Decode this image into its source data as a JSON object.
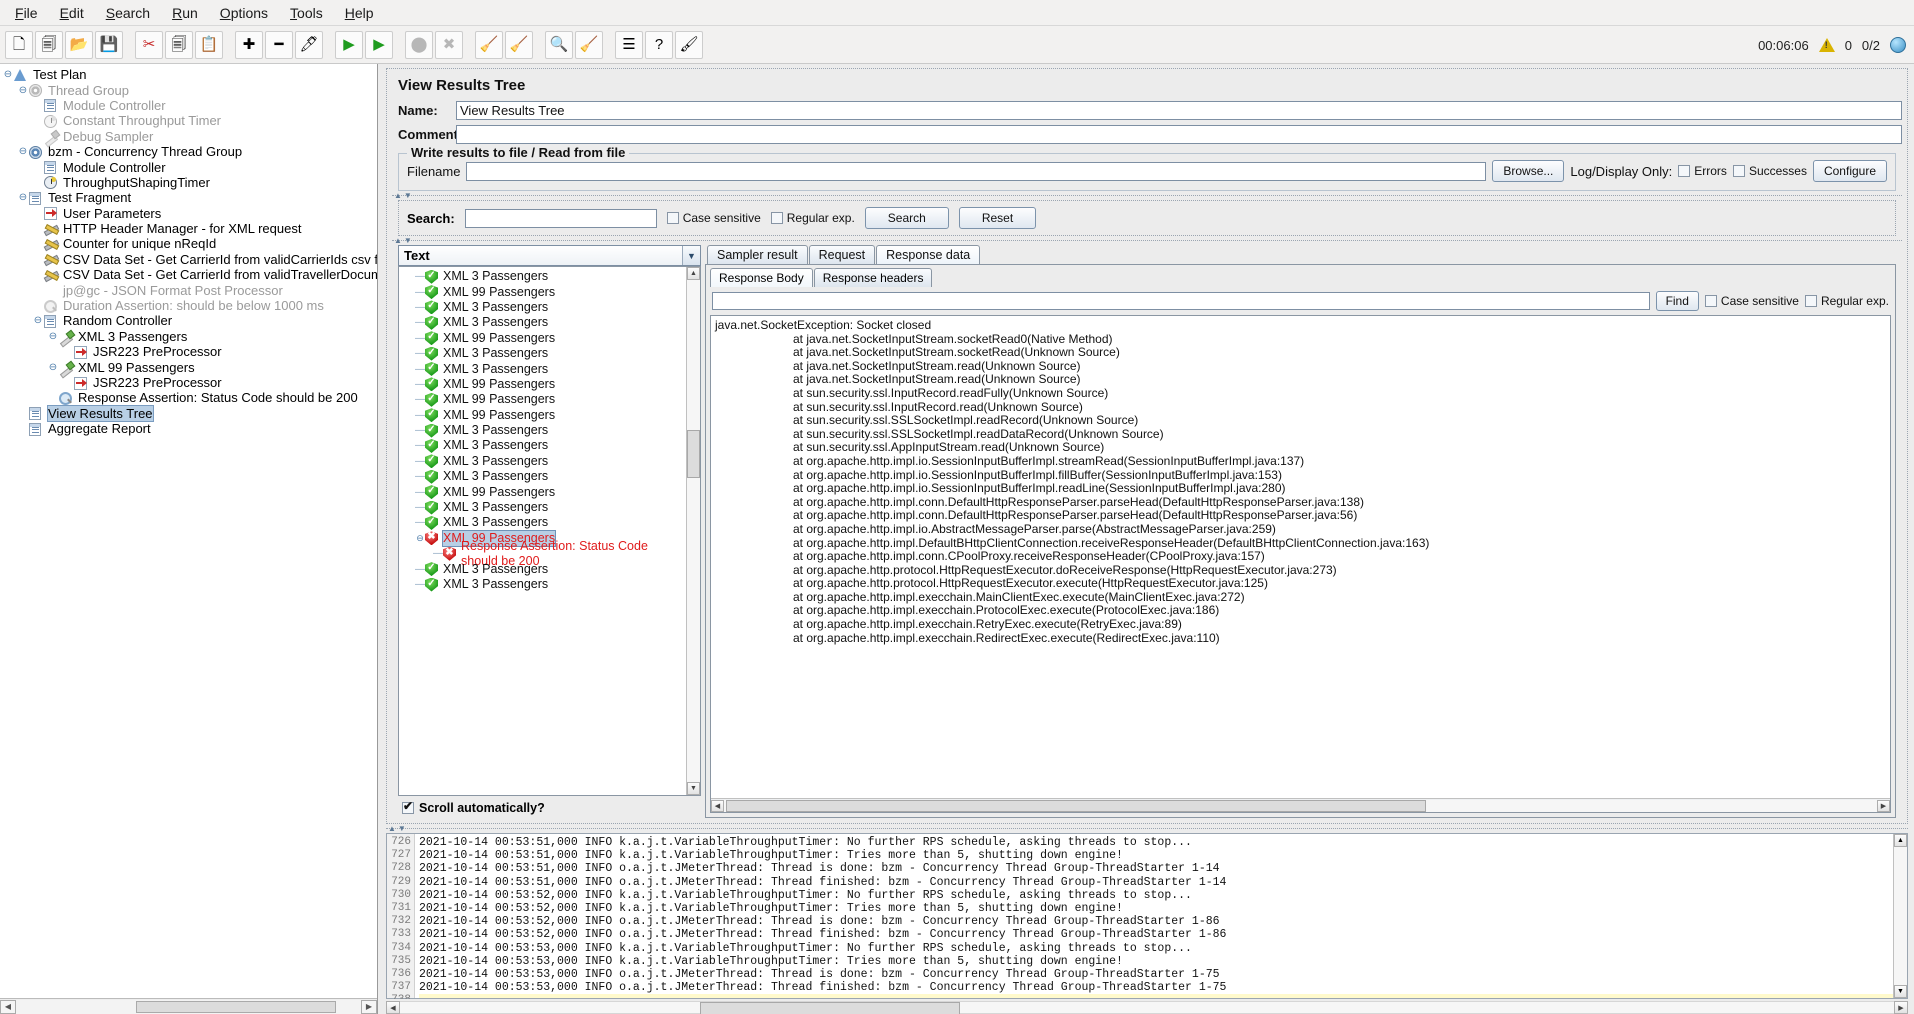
{
  "menu": {
    "items": [
      "File",
      "Edit",
      "Search",
      "Run",
      "Options",
      "Tools",
      "Help"
    ]
  },
  "toolbar": {
    "buttons": [
      {
        "name": "new",
        "glyph": "🗋"
      },
      {
        "name": "templates",
        "glyph": "🗐"
      },
      {
        "name": "open",
        "glyph": "📂"
      },
      {
        "name": "save",
        "glyph": "💾"
      },
      {
        "name": "cut",
        "glyph": "✂"
      },
      {
        "name": "copy",
        "glyph": "🗐"
      },
      {
        "name": "paste",
        "glyph": "📋"
      },
      {
        "name": "expand-all",
        "glyph": "✚"
      },
      {
        "name": "collapse-all",
        "glyph": "━"
      },
      {
        "name": "toggle",
        "glyph": "🖊"
      },
      {
        "name": "start",
        "glyph": "▶"
      },
      {
        "name": "start-no-pauses",
        "glyph": "▶"
      },
      {
        "name": "stop",
        "glyph": "⬤"
      },
      {
        "name": "shutdown",
        "glyph": "✖"
      },
      {
        "name": "clear",
        "glyph": "🧹"
      },
      {
        "name": "clear-all",
        "glyph": "🧹"
      },
      {
        "name": "search",
        "glyph": "🔍"
      },
      {
        "name": "reset-search",
        "glyph": "🧹"
      },
      {
        "name": "function-helper",
        "glyph": "☰"
      },
      {
        "name": "help",
        "glyph": "?"
      },
      {
        "name": "undo-redo",
        "glyph": "🖌"
      }
    ],
    "elapsed": "00:06:06",
    "warnings": "0",
    "threads": "0/2"
  },
  "tree": {
    "nodes": [
      {
        "indent": 0,
        "handle": "−",
        "icon": "flask",
        "label": "Test Plan",
        "dim": false
      },
      {
        "indent": 1,
        "handle": "−",
        "icon": "gear",
        "label": "Thread Group",
        "dim": true
      },
      {
        "indent": 2,
        "handle": "",
        "icon": "doc",
        "label": "Module Controller",
        "dim": true
      },
      {
        "indent": 2,
        "handle": "",
        "icon": "clock",
        "label": "Constant Throughput Timer",
        "dim": true
      },
      {
        "indent": 2,
        "handle": "",
        "icon": "pen",
        "label": "Debug Sampler",
        "dim": true
      },
      {
        "indent": 1,
        "handle": "−",
        "icon": "gear",
        "label": "bzm - Concurrency Thread Group",
        "dim": false
      },
      {
        "indent": 2,
        "handle": "",
        "icon": "doc",
        "label": "Module Controller",
        "dim": false
      },
      {
        "indent": 2,
        "handle": "",
        "icon": "clock",
        "label": "ThroughputShapingTimer",
        "dim": false
      },
      {
        "indent": 1,
        "handle": "−",
        "icon": "doc",
        "label": "Test Fragment",
        "dim": false
      },
      {
        "indent": 2,
        "handle": "",
        "icon": "arrow",
        "label": "User Parameters",
        "dim": false
      },
      {
        "indent": 2,
        "handle": "",
        "icon": "wrench",
        "label": "HTTP Header Manager - for XML request",
        "dim": false
      },
      {
        "indent": 2,
        "handle": "",
        "icon": "wrench",
        "label": "Counter for unique nReqId",
        "dim": false
      },
      {
        "indent": 2,
        "handle": "",
        "icon": "wrench",
        "label": "CSV Data Set - Get CarrierId from validCarrierIds csv file",
        "dim": false
      },
      {
        "indent": 2,
        "handle": "",
        "icon": "wrench",
        "label": "CSV Data Set - Get CarrierId from validTravellerDocuments",
        "dim": false
      },
      {
        "indent": 2,
        "handle": "",
        "icon": "arrowb",
        "label": "jp@gc - JSON Format Post Processor",
        "dim": true
      },
      {
        "indent": 2,
        "handle": "",
        "icon": "mag",
        "label": "Duration Assertion: should be below 1000 ms",
        "dim": true
      },
      {
        "indent": 2,
        "handle": "−",
        "icon": "doc",
        "label": "Random Controller",
        "dim": false
      },
      {
        "indent": 3,
        "handle": "−",
        "icon": "pen",
        "label": "XML 3 Passengers",
        "dim": false
      },
      {
        "indent": 4,
        "handle": "",
        "icon": "arrow",
        "label": "JSR223 PreProcessor",
        "dim": false
      },
      {
        "indent": 3,
        "handle": "−",
        "icon": "pen",
        "label": "XML 99 Passengers",
        "dim": false
      },
      {
        "indent": 4,
        "handle": "",
        "icon": "arrow",
        "label": "JSR223 PreProcessor",
        "dim": false
      },
      {
        "indent": 3,
        "handle": "",
        "icon": "mag",
        "label": "Response Assertion: Status Code should be 200",
        "dim": false
      },
      {
        "indent": 1,
        "handle": "",
        "icon": "doc",
        "label": "View Results Tree",
        "dim": false,
        "selected": true
      },
      {
        "indent": 1,
        "handle": "",
        "icon": "doc",
        "label": "Aggregate Report",
        "dim": false
      }
    ]
  },
  "panel": {
    "title": "View Results Tree",
    "name_label": "Name:",
    "name_value": "View Results Tree",
    "comments_label": "Comments:",
    "comments_value": "",
    "file_group_title": "Write results to file / Read from file",
    "filename_label": "Filename",
    "filename_value": "",
    "browse_label": "Browse...",
    "log_display_label": "Log/Display Only:",
    "errors_label": "Errors",
    "successes_label": "Successes",
    "configure_label": "Configure"
  },
  "search": {
    "label": "Search:",
    "value": "",
    "case_sensitive_label": "Case sensitive",
    "regular_exp_label": "Regular exp.",
    "search_button": "Search",
    "reset_button": "Reset"
  },
  "results": {
    "renderer_selected": "Text",
    "scroll_label": "Scroll automatically?",
    "scroll_checked": true,
    "items": [
      {
        "label": "XML 3 Passengers",
        "status": "ok"
      },
      {
        "label": "XML 99 Passengers",
        "status": "ok"
      },
      {
        "label": "XML 3 Passengers",
        "status": "ok"
      },
      {
        "label": "XML 3 Passengers",
        "status": "ok"
      },
      {
        "label": "XML 99 Passengers",
        "status": "ok"
      },
      {
        "label": "XML 3 Passengers",
        "status": "ok"
      },
      {
        "label": "XML 3 Passengers",
        "status": "ok"
      },
      {
        "label": "XML 99 Passengers",
        "status": "ok"
      },
      {
        "label": "XML 99 Passengers",
        "status": "ok"
      },
      {
        "label": "XML 99 Passengers",
        "status": "ok"
      },
      {
        "label": "XML 3 Passengers",
        "status": "ok"
      },
      {
        "label": "XML 3 Passengers",
        "status": "ok"
      },
      {
        "label": "XML 3 Passengers",
        "status": "ok"
      },
      {
        "label": "XML 3 Passengers",
        "status": "ok"
      },
      {
        "label": "XML 99 Passengers",
        "status": "ok"
      },
      {
        "label": "XML 3 Passengers",
        "status": "ok"
      },
      {
        "label": "XML 3 Passengers",
        "status": "ok"
      },
      {
        "label": "XML 99 Passengers",
        "status": "fail",
        "selected": true
      },
      {
        "label": "Response Assertion: Status Code should be 200",
        "status": "fail",
        "child": true
      },
      {
        "label": "XML 3 Passengers",
        "status": "ok"
      },
      {
        "label": "XML 3 Passengers",
        "status": "ok"
      }
    ]
  },
  "tabs": {
    "main": [
      {
        "label": "Sampler result",
        "active": false
      },
      {
        "label": "Request",
        "active": false
      },
      {
        "label": "Response data",
        "active": true
      }
    ],
    "sub": [
      {
        "label": "Response Body",
        "active": true
      },
      {
        "label": "Response headers",
        "active": false
      }
    ],
    "find_value": "",
    "find_button": "Find",
    "case_sensitive_label": "Case sensitive",
    "regular_exp_label": "Regular exp."
  },
  "response": {
    "lines": [
      {
        "text": "java.net.SocketException: Socket closed",
        "indent": false
      },
      {
        "text": "at java.net.SocketInputStream.socketRead0(Native Method)",
        "indent": true
      },
      {
        "text": "at java.net.SocketInputStream.socketRead(Unknown Source)",
        "indent": true
      },
      {
        "text": "at java.net.SocketInputStream.read(Unknown Source)",
        "indent": true
      },
      {
        "text": "at java.net.SocketInputStream.read(Unknown Source)",
        "indent": true
      },
      {
        "text": "at sun.security.ssl.InputRecord.readFully(Unknown Source)",
        "indent": true
      },
      {
        "text": "at sun.security.ssl.InputRecord.read(Unknown Source)",
        "indent": true
      },
      {
        "text": "at sun.security.ssl.SSLSocketImpl.readRecord(Unknown Source)",
        "indent": true
      },
      {
        "text": "at sun.security.ssl.SSLSocketImpl.readDataRecord(Unknown Source)",
        "indent": true
      },
      {
        "text": "at sun.security.ssl.AppInputStream.read(Unknown Source)",
        "indent": true
      },
      {
        "text": "at org.apache.http.impl.io.SessionInputBufferImpl.streamRead(SessionInputBufferImpl.java:137)",
        "indent": true
      },
      {
        "text": "at org.apache.http.impl.io.SessionInputBufferImpl.fillBuffer(SessionInputBufferImpl.java:153)",
        "indent": true
      },
      {
        "text": "at org.apache.http.impl.io.SessionInputBufferImpl.readLine(SessionInputBufferImpl.java:280)",
        "indent": true
      },
      {
        "text": "at org.apache.http.impl.conn.DefaultHttpResponseParser.parseHead(DefaultHttpResponseParser.java:138)",
        "indent": true
      },
      {
        "text": "at org.apache.http.impl.conn.DefaultHttpResponseParser.parseHead(DefaultHttpResponseParser.java:56)",
        "indent": true
      },
      {
        "text": "at org.apache.http.impl.io.AbstractMessageParser.parse(AbstractMessageParser.java:259)",
        "indent": true
      },
      {
        "text": "at org.apache.http.impl.DefaultBHttpClientConnection.receiveResponseHeader(DefaultBHttpClientConnection.java:163)",
        "indent": true
      },
      {
        "text": "at org.apache.http.impl.conn.CPoolProxy.receiveResponseHeader(CPoolProxy.java:157)",
        "indent": true
      },
      {
        "text": "at org.apache.http.protocol.HttpRequestExecutor.doReceiveResponse(HttpRequestExecutor.java:273)",
        "indent": true
      },
      {
        "text": "at org.apache.http.protocol.HttpRequestExecutor.execute(HttpRequestExecutor.java:125)",
        "indent": true
      },
      {
        "text": "at org.apache.http.impl.execchain.MainClientExec.execute(MainClientExec.java:272)",
        "indent": true
      },
      {
        "text": "at org.apache.http.impl.execchain.ProtocolExec.execute(ProtocolExec.java:186)",
        "indent": true
      },
      {
        "text": "at org.apache.http.impl.execchain.RetryExec.execute(RetryExec.java:89)",
        "indent": true
      },
      {
        "text": "at org.apache.http.impl.execchain.RedirectExec.execute(RedirectExec.java:110)",
        "indent": true
      }
    ]
  },
  "log": {
    "lines": [
      {
        "no": "726",
        "text": "2021-10-14 00:53:51,000 INFO k.a.j.t.VariableThroughputTimer: No further RPS schedule, asking threads to stop..."
      },
      {
        "no": "727",
        "text": "2021-10-14 00:53:51,000 INFO k.a.j.t.VariableThroughputTimer: Tries more than 5, shutting down engine!"
      },
      {
        "no": "728",
        "text": "2021-10-14 00:53:51,000 INFO o.a.j.t.JMeterThread: Thread is done: bzm - Concurrency Thread Group-ThreadStarter 1-14"
      },
      {
        "no": "729",
        "text": "2021-10-14 00:53:51,000 INFO o.a.j.t.JMeterThread: Thread finished: bzm - Concurrency Thread Group-ThreadStarter 1-14"
      },
      {
        "no": "730",
        "text": "2021-10-14 00:53:52,000 INFO k.a.j.t.VariableThroughputTimer: No further RPS schedule, asking threads to stop..."
      },
      {
        "no": "731",
        "text": "2021-10-14 00:53:52,000 INFO k.a.j.t.VariableThroughputTimer: Tries more than 5, shutting down engine!"
      },
      {
        "no": "732",
        "text": "2021-10-14 00:53:52,000 INFO o.a.j.t.JMeterThread: Thread is done: bzm - Concurrency Thread Group-ThreadStarter 1-86"
      },
      {
        "no": "733",
        "text": "2021-10-14 00:53:52,000 INFO o.a.j.t.JMeterThread: Thread finished: bzm - Concurrency Thread Group-ThreadStarter 1-86"
      },
      {
        "no": "734",
        "text": "2021-10-14 00:53:53,000 INFO k.a.j.t.VariableThroughputTimer: No further RPS schedule, asking threads to stop..."
      },
      {
        "no": "735",
        "text": "2021-10-14 00:53:53,000 INFO k.a.j.t.VariableThroughputTimer: Tries more than 5, shutting down engine!"
      },
      {
        "no": "736",
        "text": "2021-10-14 00:53:53,000 INFO o.a.j.t.JMeterThread: Thread is done: bzm - Concurrency Thread Group-ThreadStarter 1-75"
      },
      {
        "no": "737",
        "text": "2021-10-14 00:53:53,000 INFO o.a.j.t.JMeterThread: Thread finished: bzm - Concurrency Thread Group-ThreadStarter 1-75"
      },
      {
        "no": "738",
        "text": "",
        "highlight": true
      }
    ]
  }
}
